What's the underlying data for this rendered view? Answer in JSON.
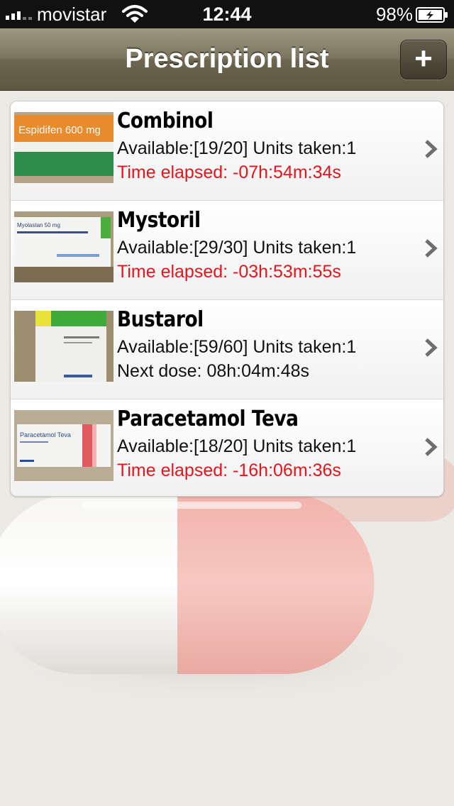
{
  "status_bar": {
    "carrier": "movistar",
    "time": "12:44",
    "battery_percent": "98%"
  },
  "nav": {
    "title": "Prescription list",
    "add_button_label": "+"
  },
  "prescriptions": [
    {
      "name": "Combinol",
      "availability": "Available:[19/20] Units taken:1",
      "timer": "Time elapsed: -07h:54m:34s",
      "timer_status": "overdue",
      "box_label": "Espidifen 600 mg"
    },
    {
      "name": "Mystoril",
      "availability": "Available:[29/30] Units taken:1",
      "timer": "Time elapsed: -03h:53m:55s",
      "timer_status": "overdue",
      "box_label": "Myolastan 50 mg"
    },
    {
      "name": "Bustarol",
      "availability": "Available:[59/60] Units taken:1",
      "timer": "Next dose: 08h:04m:48s",
      "timer_status": "upcoming",
      "box_label": ""
    },
    {
      "name": "Paracetamol Teva",
      "availability": "Available:[18/20] Units taken:1",
      "timer": "Time elapsed: -16h:06m:36s",
      "timer_status": "overdue",
      "box_label": "Paracetamol Teva"
    }
  ],
  "colors": {
    "overdue_text": "#e8141b",
    "nav_bar": "#7b7560",
    "background": "#ebe9e4"
  },
  "icons": [
    "wifi-icon",
    "battery-charging-icon",
    "add-icon",
    "chevron-right-icon"
  ]
}
